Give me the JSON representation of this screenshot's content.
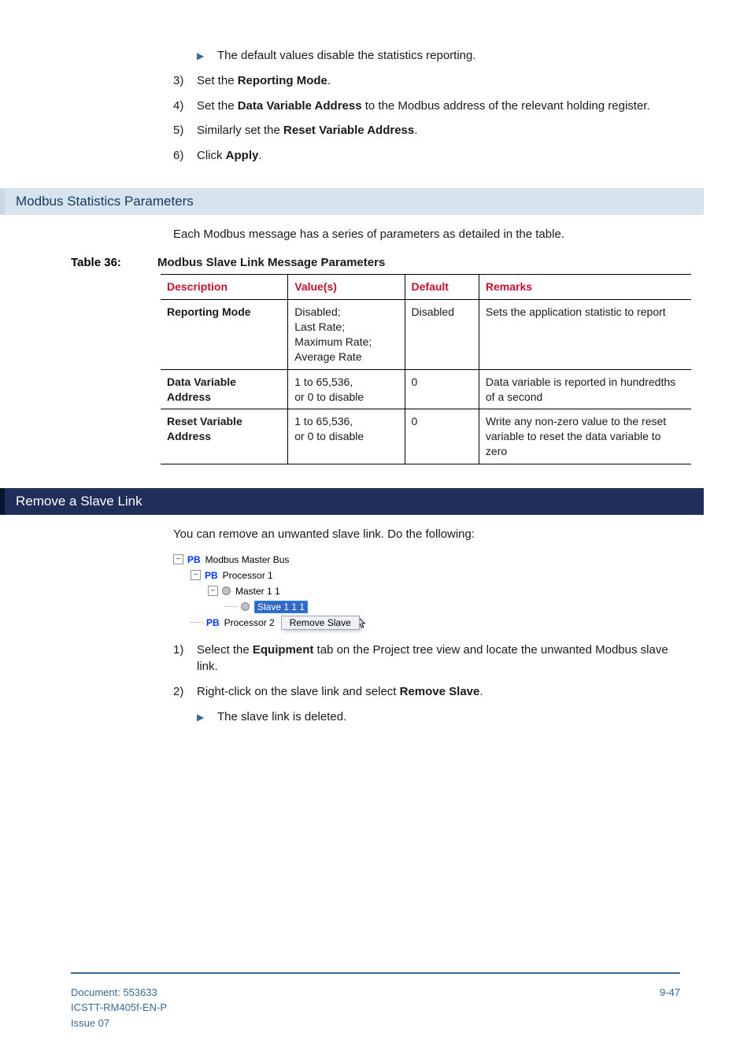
{
  "top_bullets": [
    "The default values disable the statistics reporting."
  ],
  "steps_top": [
    {
      "n": "3)",
      "pre": "Set the ",
      "bold": "Reporting Mode",
      "post": "."
    },
    {
      "n": "4)",
      "pre": "Set the ",
      "bold": "Data Variable Address",
      "post": " to the Modbus address of the relevant holding register."
    },
    {
      "n": "5)",
      "pre": "Similarly set the ",
      "bold": "Reset Variable Address",
      "post": "."
    },
    {
      "n": "6)",
      "pre": "Click ",
      "bold": "Apply",
      "post": "."
    }
  ],
  "section_light": "Modbus Statistics Parameters",
  "light_intro": "Each Modbus message has a series of parameters as detailed in the table.",
  "table_label": "Table 36:",
  "table_title": "Modbus Slave Link Message Parameters",
  "table_headers": [
    "Description",
    "Value(s)",
    "Default",
    "Remarks"
  ],
  "table_rows": [
    {
      "desc": "Reporting Mode",
      "values": "Disabled;\nLast Rate;\nMaximum Rate;\nAverage Rate",
      "default": "Disabled",
      "remarks": "Sets the application statistic to report"
    },
    {
      "desc": "Data Variable Address",
      "values": "1 to 65,536,\nor 0 to disable",
      "default": "0",
      "remarks": "Data variable is reported in hundredths of a second"
    },
    {
      "desc": "Reset Variable Address",
      "values": "1 to 65,536,\nor 0 to disable",
      "default": "0",
      "remarks": "Write any non-zero value to the reset variable to reset the data variable to zero"
    }
  ],
  "section_dark": "Remove a Slave Link",
  "dark_intro": "You can remove an unwanted slave link. Do the following:",
  "tree": {
    "root": "Modbus Master Bus",
    "proc1": "Processor 1",
    "master": "Master 1 1",
    "slave": "Slave 1 1 1",
    "proc2": "Processor 2",
    "context": "Remove Slave"
  },
  "steps_dark": [
    {
      "n": "1)",
      "pre": "Select the ",
      "bold": "Equipment",
      "post": " tab on the Project tree view and locate the unwanted Modbus slave link."
    },
    {
      "n": "2)",
      "pre": "Right-click on the slave link and select ",
      "bold": "Remove Slave",
      "post": "."
    }
  ],
  "dark_bullets": [
    "The slave link is deleted."
  ],
  "footer": {
    "doc": "Document: 553633",
    "ref": "ICSTT-RM405f-EN-P",
    "issue": "Issue 07",
    "page": "9-47"
  }
}
